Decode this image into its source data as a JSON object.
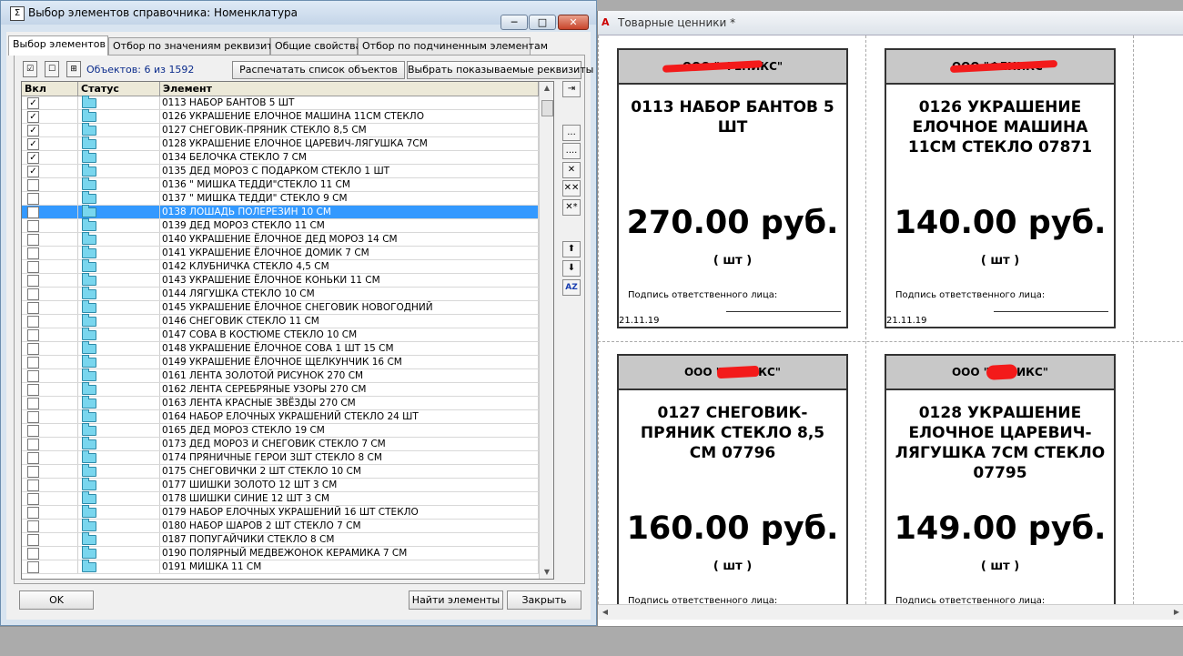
{
  "dialog": {
    "title": "Выбор элементов справочника:  Номенклатура",
    "title_icon": "Σ",
    "buttons": {
      "minimize": "─",
      "maximize": "□",
      "close": "✕"
    },
    "tabs": [
      {
        "label": "Выбор элементов",
        "active": true
      },
      {
        "label": "Отбор по значениям реквизитов",
        "active": false
      },
      {
        "label": "Общие свойства",
        "active": false
      },
      {
        "label": "Отбор по подчиненным элементам",
        "active": false
      }
    ],
    "toolbar_icons": [
      "check-all-icon",
      "uncheck-all-icon",
      "invert-check-icon"
    ],
    "objects_count": "Объектов: 6 из 1592",
    "print_button": "Распечатать список объектов",
    "choose_fields_button": "Выбрать показываемые реквизиты",
    "columns": [
      "Вкл",
      "Статус",
      "Элемент"
    ],
    "rows": [
      {
        "checked": true,
        "name": "0113 НАБОР БАНТОВ 5 ШТ"
      },
      {
        "checked": true,
        "name": "0126 УКРАШЕНИЕ ЕЛОЧНОЕ МАШИНА 11СМ СТЕКЛО"
      },
      {
        "checked": true,
        "name": "0127  СНЕГОВИК-ПРЯНИК СТЕКЛО 8,5 СМ"
      },
      {
        "checked": true,
        "name": "0128 УКРАШЕНИЕ ЕЛОЧНОЕ ЦАРЕВИЧ-ЛЯГУШКА 7СМ"
      },
      {
        "checked": true,
        "name": "0134 БЕЛОЧКА СТЕКЛО 7 СМ"
      },
      {
        "checked": true,
        "name": "0135 ДЕД МОРОЗ С ПОДАРКОМ СТЕКЛО 1 ШТ"
      },
      {
        "checked": false,
        "name": "0136 \" МИШКА ТЕДДИ\"СТЕКЛО 11 СМ"
      },
      {
        "checked": false,
        "name": "0137 \" МИШКА ТЕДДИ\" СТЕКЛО 9 СМ"
      },
      {
        "checked": false,
        "name": "0138 ЛОШАДЬ ПОЛЕРЕЗИН 10 СМ",
        "selected": true
      },
      {
        "checked": false,
        "name": "0139  ДЕД МОРОЗ СТЕКЛО 11 СМ"
      },
      {
        "checked": false,
        "name": "0140 УКРАШЕНИЕ ЁЛОЧНОЕ ДЕД МОРОЗ 14 СМ"
      },
      {
        "checked": false,
        "name": "0141 УКРАШЕНИЕ ЁЛОЧНОЕ ДОМИК 7 СМ"
      },
      {
        "checked": false,
        "name": "0142  КЛУБНИЧКА СТЕКЛО 4,5 СМ"
      },
      {
        "checked": false,
        "name": "0143 УКРАШЕНИЕ ЁЛОЧНОЕ КОНЬКИ 11 СМ"
      },
      {
        "checked": false,
        "name": "0144  ЛЯГУШКА  СТЕКЛО 10 СМ"
      },
      {
        "checked": false,
        "name": "0145 УКРАШЕНИЕ ЁЛОЧНОЕ СНЕГОВИК НОВОГОДНИЙ"
      },
      {
        "checked": false,
        "name": "0146  СНЕГОВИК  СТЕКЛО 11 СМ"
      },
      {
        "checked": false,
        "name": "0147  СОВА В КОСТЮМЕ СТЕКЛО 10 СМ"
      },
      {
        "checked": false,
        "name": "0148 УКРАШЕНИЕ ЁЛОЧНОЕ СОВА 1 ШТ 15 СМ"
      },
      {
        "checked": false,
        "name": "0149  УКРАШЕНИЕ ЁЛОЧНОЕ ЩЕЛКУНЧИК 16 СМ"
      },
      {
        "checked": false,
        "name": "0161 ЛЕНТА ЗОЛОТОЙ РИСУНОК 270 СМ"
      },
      {
        "checked": false,
        "name": "0162 ЛЕНТА СЕРЕБРЯНЫЕ УЗОРЫ 270 СМ"
      },
      {
        "checked": false,
        "name": "0163 ЛЕНТА КРАСНЫЕ ЗВЁЗДЫ 270 СМ"
      },
      {
        "checked": false,
        "name": "0164 НАБОР ЕЛОЧНЫХ УКРАШЕНИЙ  СТЕКЛО 24 ШТ"
      },
      {
        "checked": false,
        "name": "0165 ДЕД МОРОЗ  СТЕКЛО 19 СМ"
      },
      {
        "checked": false,
        "name": "0173 ДЕД МОРОЗ И СНЕГОВИК СТЕКЛО 7 СМ"
      },
      {
        "checked": false,
        "name": "0174 ПРЯНИЧНЫЕ ГЕРОИ 3ШТ СТЕКЛО 8 СМ"
      },
      {
        "checked": false,
        "name": "0175 СНЕГОВИЧКИ 2 ШТ СТЕКЛО 10 СМ"
      },
      {
        "checked": false,
        "name": "0177 ШИШКИ  ЗОЛОТО 12 ШТ 3 СМ"
      },
      {
        "checked": false,
        "name": "0178 ШИШКИ СИНИЕ 12 ШТ 3 СМ"
      },
      {
        "checked": false,
        "name": "0179 НАБОР ЕЛОЧНЫХ УКРАШЕНИЙ 16 ШТ СТЕКЛО"
      },
      {
        "checked": false,
        "name": "0180 НАБОР ШАРОВ 2 ШТ СТЕКЛО 7 СМ"
      },
      {
        "checked": false,
        "name": "0187 ПОПУГАЙЧИКИ СТЕКЛО  8 СМ"
      },
      {
        "checked": false,
        "name": "0190 ПОЛЯРНЫЙ МЕДВЕЖОНОК КЕРАМИКА  7 СМ"
      },
      {
        "checked": false,
        "name": "0191 МИШКА 11 СМ"
      }
    ],
    "side_buttons": [
      "...",
      "....",
      "✕",
      "✕✕",
      "✕*",
      "⬆",
      "⬇",
      "AZ"
    ],
    "ok_button": "OK",
    "find_button": "Найти элементы",
    "close_button": "Закрыть"
  },
  "price_tags": {
    "title": "Товарные ценники  *",
    "tags": [
      {
        "org": "ООО \"  ФЕНИКС\"",
        "name": "0113 НАБОР БАНТОВ 5 ШТ",
        "price": "270.00 руб.",
        "unit": "( шт )",
        "sign": "Подпись ответственного лица:",
        "date": "21.11.19"
      },
      {
        "org": "ООО \"ФЕНИКС\"",
        "name": "0126 УКРАШЕНИЕ ЕЛОЧНОЕ МАШИНА 11СМ СТЕКЛО 07871",
        "price": "140.00 руб.",
        "unit": "( шт )",
        "sign": "Подпись ответственного лица:",
        "date": "21.11.19"
      },
      {
        "org": "ООО \"ФЕНИКС\"",
        "name": "0127 СНЕГОВИК-ПРЯНИК СТЕКЛО 8,5 СМ 07796",
        "price": "160.00 руб.",
        "unit": "( шт )",
        "sign": "Подпись ответственного лица:",
        "date": ""
      },
      {
        "org": "ООО \"ФЕНИКС\"",
        "name": "0128 УКРАШЕНИЕ ЕЛОЧНОЕ ЦАРЕВИЧ-ЛЯГУШКА 7СМ СТЕКЛО 07795",
        "price": "149.00 руб.",
        "unit": "( шт )",
        "sign": "Подпись ответственного лица:",
        "date": ""
      }
    ]
  },
  "colors": {
    "selection": "#3399ff",
    "redaction": "#f31a1a",
    "tag_header": "#c8c8c8"
  }
}
